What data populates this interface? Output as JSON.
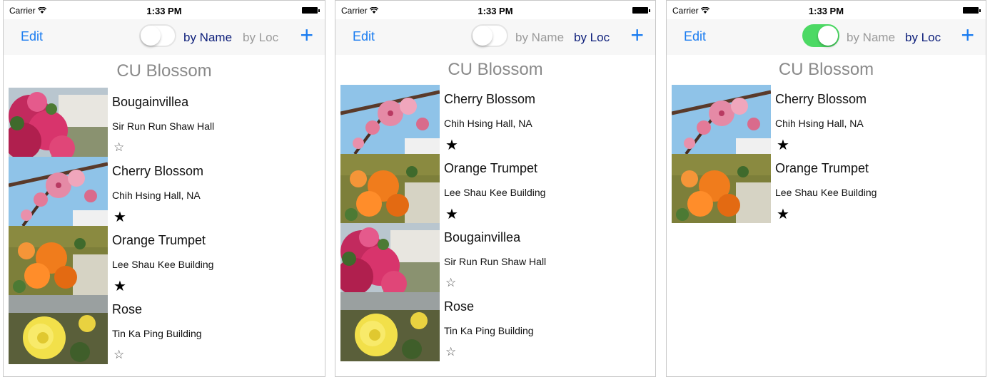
{
  "screens": [
    {
      "status": {
        "carrier": "Carrier",
        "time": "1:33 PM"
      },
      "nav": {
        "edit": "Edit",
        "toggle_on": false,
        "by_name": "by Name",
        "by_loc": "by Loc",
        "active": "name",
        "add": "+"
      },
      "section_title": "CU Blossom",
      "rows": [
        {
          "title": "Bougainvillea",
          "subtitle": "Sir Run Run Shaw Hall",
          "star": "☆",
          "favorite": false,
          "image": "bougainvillea"
        },
        {
          "title": "Cherry Blossom",
          "subtitle": "Chih Hsing Hall, NA",
          "star": "★",
          "favorite": true,
          "image": "cherry"
        },
        {
          "title": "Orange Trumpet",
          "subtitle": "Lee Shau Kee Building",
          "star": "★",
          "favorite": true,
          "image": "orange"
        },
        {
          "title": "Rose",
          "subtitle": "Tin Ka Ping Building",
          "star": "☆",
          "favorite": false,
          "image": "rose"
        }
      ]
    },
    {
      "status": {
        "carrier": "Carrier",
        "time": "1:33 PM"
      },
      "nav": {
        "edit": "Edit",
        "toggle_on": false,
        "by_name": "by Name",
        "by_loc": "by Loc",
        "active": "loc",
        "add": "+"
      },
      "section_title": "CU Blossom",
      "rows": [
        {
          "title": "Cherry Blossom",
          "subtitle": "Chih Hsing Hall, NA",
          "star": "★",
          "favorite": true,
          "image": "cherry"
        },
        {
          "title": "Orange Trumpet",
          "subtitle": "Lee Shau Kee Building",
          "star": "★",
          "favorite": true,
          "image": "orange"
        },
        {
          "title": "Bougainvillea",
          "subtitle": "Sir Run Run Shaw Hall",
          "star": "☆",
          "favorite": false,
          "image": "bougainvillea"
        },
        {
          "title": "Rose",
          "subtitle": "Tin Ka Ping Building",
          "star": "☆",
          "favorite": false,
          "image": "rose"
        }
      ]
    },
    {
      "status": {
        "carrier": "Carrier",
        "time": "1:33 PM"
      },
      "nav": {
        "edit": "Edit",
        "toggle_on": true,
        "by_name": "by Name",
        "by_loc": "by Loc",
        "active": "loc",
        "add": "+"
      },
      "section_title": "CU Blossom",
      "rows": [
        {
          "title": "Cherry Blossom",
          "subtitle": "Chih Hsing Hall, NA",
          "star": "★",
          "favorite": true,
          "image": "cherry"
        },
        {
          "title": "Orange Trumpet",
          "subtitle": "Lee Shau Kee Building",
          "star": "★",
          "favorite": true,
          "image": "orange"
        }
      ]
    }
  ],
  "colors": {
    "tint": "#1a7cf0",
    "segment_active": "#0c1e7a",
    "segment_inactive": "#9a9a9a",
    "switch_on": "#4cd964",
    "title_gray": "#8a8a8a"
  }
}
